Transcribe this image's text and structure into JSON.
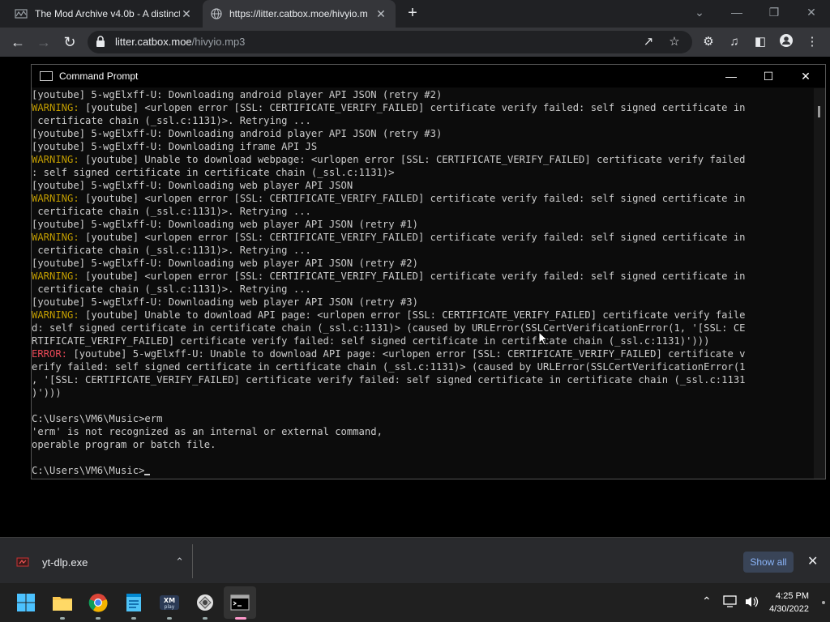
{
  "browser": {
    "tabs": [
      {
        "title": "The Mod Archive v4.0b - A distinct",
        "close": "✕"
      },
      {
        "title": "https://litter.catbox.moe/hivyio.m",
        "close": "✕"
      }
    ],
    "new_tab": "+",
    "url_host": "litter.catbox.moe",
    "url_path": "/hivyio.mp3"
  },
  "cmd": {
    "title": "Command Prompt",
    "lines": [
      {
        "type": "normal",
        "prefix": "",
        "text": "[youtube] 5-wgElxff-U: Downloading android player API JSON (retry #2)"
      },
      {
        "type": "warn",
        "prefix": "WARNING:",
        "text": " [youtube] <urlopen error [SSL: CERTIFICATE_VERIFY_FAILED] certificate verify failed: self signed certificate in"
      },
      {
        "type": "normal",
        "prefix": "",
        "text": " certificate chain (_ssl.c:1131)>. Retrying ..."
      },
      {
        "type": "normal",
        "prefix": "",
        "text": "[youtube] 5-wgElxff-U: Downloading android player API JSON (retry #3)"
      },
      {
        "type": "normal",
        "prefix": "",
        "text": "[youtube] 5-wgElxff-U: Downloading iframe API JS"
      },
      {
        "type": "warn",
        "prefix": "WARNING:",
        "text": " [youtube] Unable to download webpage: <urlopen error [SSL: CERTIFICATE_VERIFY_FAILED] certificate verify failed"
      },
      {
        "type": "normal",
        "prefix": "",
        "text": ": self signed certificate in certificate chain (_ssl.c:1131)>"
      },
      {
        "type": "normal",
        "prefix": "",
        "text": "[youtube] 5-wgElxff-U: Downloading web player API JSON"
      },
      {
        "type": "warn",
        "prefix": "WARNING:",
        "text": " [youtube] <urlopen error [SSL: CERTIFICATE_VERIFY_FAILED] certificate verify failed: self signed certificate in"
      },
      {
        "type": "normal",
        "prefix": "",
        "text": " certificate chain (_ssl.c:1131)>. Retrying ..."
      },
      {
        "type": "normal",
        "prefix": "",
        "text": "[youtube] 5-wgElxff-U: Downloading web player API JSON (retry #1)"
      },
      {
        "type": "warn",
        "prefix": "WARNING:",
        "text": " [youtube] <urlopen error [SSL: CERTIFICATE_VERIFY_FAILED] certificate verify failed: self signed certificate in"
      },
      {
        "type": "normal",
        "prefix": "",
        "text": " certificate chain (_ssl.c:1131)>. Retrying ..."
      },
      {
        "type": "normal",
        "prefix": "",
        "text": "[youtube] 5-wgElxff-U: Downloading web player API JSON (retry #2)"
      },
      {
        "type": "warn",
        "prefix": "WARNING:",
        "text": " [youtube] <urlopen error [SSL: CERTIFICATE_VERIFY_FAILED] certificate verify failed: self signed certificate in"
      },
      {
        "type": "normal",
        "prefix": "",
        "text": " certificate chain (_ssl.c:1131)>. Retrying ..."
      },
      {
        "type": "normal",
        "prefix": "",
        "text": "[youtube] 5-wgElxff-U: Downloading web player API JSON (retry #3)"
      },
      {
        "type": "warn",
        "prefix": "WARNING:",
        "text": " [youtube] Unable to download API page: <urlopen error [SSL: CERTIFICATE_VERIFY_FAILED] certificate verify faile"
      },
      {
        "type": "normal",
        "prefix": "",
        "text": "d: self signed certificate in certificate chain (_ssl.c:1131)> (caused by URLError(SSLCertVerificationError(1, '[SSL: CE"
      },
      {
        "type": "normal",
        "prefix": "",
        "text": "RTIFICATE_VERIFY_FAILED] certificate verify failed: self signed certificate in certificate chain (_ssl.c:1131)')))"
      },
      {
        "type": "err",
        "prefix": "ERROR:",
        "text": " [youtube] 5-wgElxff-U: Unable to download API page: <urlopen error [SSL: CERTIFICATE_VERIFY_FAILED] certificate v"
      },
      {
        "type": "normal",
        "prefix": "",
        "text": "erify failed: self signed certificate in certificate chain (_ssl.c:1131)> (caused by URLError(SSLCertVerificationError(1"
      },
      {
        "type": "normal",
        "prefix": "",
        "text": ", '[SSL: CERTIFICATE_VERIFY_FAILED] certificate verify failed: self signed certificate in certificate chain (_ssl.c:1131"
      },
      {
        "type": "normal",
        "prefix": "",
        "text": ")')))"
      },
      {
        "type": "normal",
        "prefix": "",
        "text": ""
      },
      {
        "type": "normal",
        "prefix": "",
        "text": "C:\\Users\\VM6\\Music>erm"
      },
      {
        "type": "normal",
        "prefix": "",
        "text": "'erm' is not recognized as an internal or external command,"
      },
      {
        "type": "normal",
        "prefix": "",
        "text": "operable program or batch file."
      },
      {
        "type": "normal",
        "prefix": "",
        "text": ""
      }
    ],
    "prompt": "C:\\Users\\VM6\\Music>"
  },
  "downloads": {
    "file_name": "yt-dlp.exe",
    "show_all": "Show all"
  },
  "taskbar": {
    "time": "4:25 PM",
    "date": "4/30/2022"
  },
  "colors": {
    "warning": "#c19c00",
    "error": "#e74856",
    "console_text": "#cccccc"
  }
}
